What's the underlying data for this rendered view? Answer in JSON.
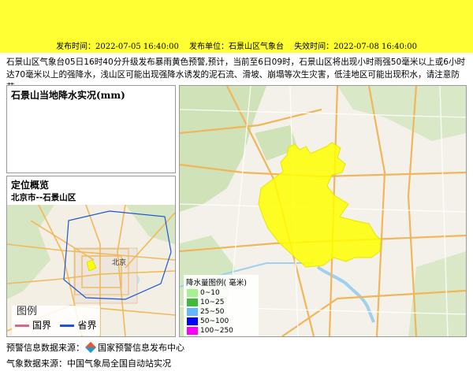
{
  "banner": {
    "issue_label": "发布时间：2022-07-05 16:40:00",
    "unit_label": "发布单位：石景山区气象台",
    "expire_label": "失效时间：2022-07-08 16:40:00",
    "color": "#ffff33"
  },
  "description": "石景山区气象台05日16时40分升级发布暴雨黄色预警,预计，当前至6日09时，石景山区将出现小时雨强50毫米以上或6小时达70毫米以上的强降水，浅山区可能出现强降水诱发的泥石流、滑坡、崩塌等次生灾害，低洼地区可能出现积水，请注意防范。",
  "rain_panel": {
    "title": "石景山当地降水实况(mm)"
  },
  "location_panel": {
    "title": "定位概览",
    "subtitle": "北京市--石景山区",
    "map_city_label": "北京",
    "legend": {
      "title": "图例",
      "items": [
        {
          "label": "国界",
          "color": "#d36a8a"
        },
        {
          "label": "省界",
          "color": "#1c55d8"
        }
      ]
    }
  },
  "rain_legend": {
    "title": "降水量图例( 毫米)",
    "items": [
      {
        "label": "0~10",
        "color": "#a6f28f"
      },
      {
        "label": "10~25",
        "color": "#3dba3d"
      },
      {
        "label": "25~50",
        "color": "#61b8ff"
      },
      {
        "label": "50~100",
        "color": "#0000fe"
      },
      {
        "label": "100~250",
        "color": "#fa00fa"
      }
    ]
  },
  "footer": {
    "warning_source_label": "预警信息数据来源：",
    "warning_source_icon": "warning-center-logo-icon",
    "warning_source_name": "国家预警信息发布中心",
    "weather_source": "气象数据来源：中国气象局全国自动站实况"
  }
}
